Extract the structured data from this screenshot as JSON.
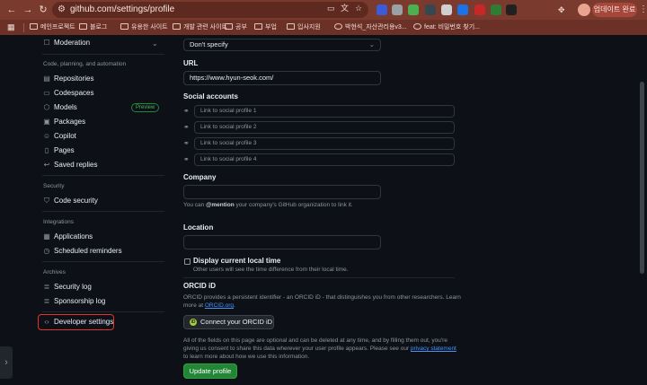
{
  "browser": {
    "url": "github.com/settings/profile",
    "update_label": "업데이트 완료",
    "extensions": [
      {
        "icon": "blue-extension-icon",
        "color": "#3b5bdb"
      },
      {
        "icon": "gray-extension-icon",
        "color": "#9aa0a6"
      },
      {
        "icon": "green-extension-icon",
        "color": "#4caf50"
      },
      {
        "icon": "dark-extension-icon",
        "color": "#37474f"
      },
      {
        "icon": "light-extension-icon",
        "color": "#d0d0d0"
      },
      {
        "icon": "check-extension-icon",
        "color": "#1a73e8"
      },
      {
        "icon": "new-extension-icon",
        "color": "#c62828"
      },
      {
        "icon": "green-dot-extension-icon",
        "color": "#2e7d32"
      },
      {
        "icon": "black-extension-icon",
        "color": "#212121"
      }
    ],
    "bookmarks": [
      {
        "label": "메인프로젝트",
        "folder": true
      },
      {
        "label": "블로그",
        "folder": true
      },
      {
        "label": "유용한 사이트",
        "folder": true
      },
      {
        "label": "개발 관련 사이트",
        "folder": true
      },
      {
        "label": "공부",
        "folder": true
      },
      {
        "label": "부업",
        "folder": true
      },
      {
        "label": "입사지원",
        "folder": true
      },
      {
        "label": "박현석_자산관리용v3...",
        "folder": false
      },
      {
        "label": "feat: 비밀번호 찾기...",
        "folder": false
      }
    ]
  },
  "sidebar": {
    "moderation": "Moderation",
    "code_heading": "Code, planning, and automation",
    "code_items": [
      {
        "label": "Repositories",
        "icon": "repo-icon"
      },
      {
        "label": "Codespaces",
        "icon": "codespaces-icon"
      },
      {
        "label": "Models",
        "icon": "models-icon",
        "badge": "Preview"
      },
      {
        "label": "Packages",
        "icon": "package-icon"
      },
      {
        "label": "Copilot",
        "icon": "copilot-icon"
      },
      {
        "label": "Pages",
        "icon": "pages-icon"
      },
      {
        "label": "Saved replies",
        "icon": "reply-icon"
      }
    ],
    "security_heading": "Security",
    "security_items": [
      {
        "label": "Code security",
        "icon": "shield-icon"
      }
    ],
    "integrations_heading": "Integrations",
    "integrations_items": [
      {
        "label": "Applications",
        "icon": "apps-icon"
      },
      {
        "label": "Scheduled reminders",
        "icon": "clock-icon"
      }
    ],
    "archives_heading": "Archives",
    "archives_items": [
      {
        "label": "Security log",
        "icon": "log-icon"
      },
      {
        "label": "Sponsorship log",
        "icon": "log-icon"
      }
    ],
    "developer_settings": "Developer settings"
  },
  "main": {
    "pronouns_value": "Don't specify",
    "url_label": "URL",
    "url_value": "https://www.hyun-seok.com/",
    "social_label": "Social accounts",
    "social_placeholders": [
      "Link to social profile 1",
      "Link to social profile 2",
      "Link to social profile 3",
      "Link to social profile 4"
    ],
    "company_label": "Company",
    "company_note_pre": "You can ",
    "company_note_mention": "@mention",
    "company_note_post": " your company's GitHub organization to link it.",
    "location_label": "Location",
    "local_time_label": "Display current local time",
    "local_time_note": "Other users will see the time difference from their local time.",
    "orcid_label": "ORCID iD",
    "orcid_note_1": "ORCID provides a persistent identifier - an ORCID iD - that distinguishes you from other researchers. Learn",
    "orcid_note_2_pre": "more at ",
    "orcid_note_2_link": "ORCID.org",
    "orcid_note_2_post": ".",
    "orcid_button": "Connect your ORCID iD",
    "footer_note_1": "All of the fields on this page are optional and can be deleted at any time, and by filling them out, you're",
    "footer_note_2_pre": "giving us consent to share this data wherever your user profile appears. Please see our ",
    "footer_note_2_link": "privacy statement",
    "footer_note_3": "to learn more about how we use this information.",
    "update_button": "Update profile"
  }
}
